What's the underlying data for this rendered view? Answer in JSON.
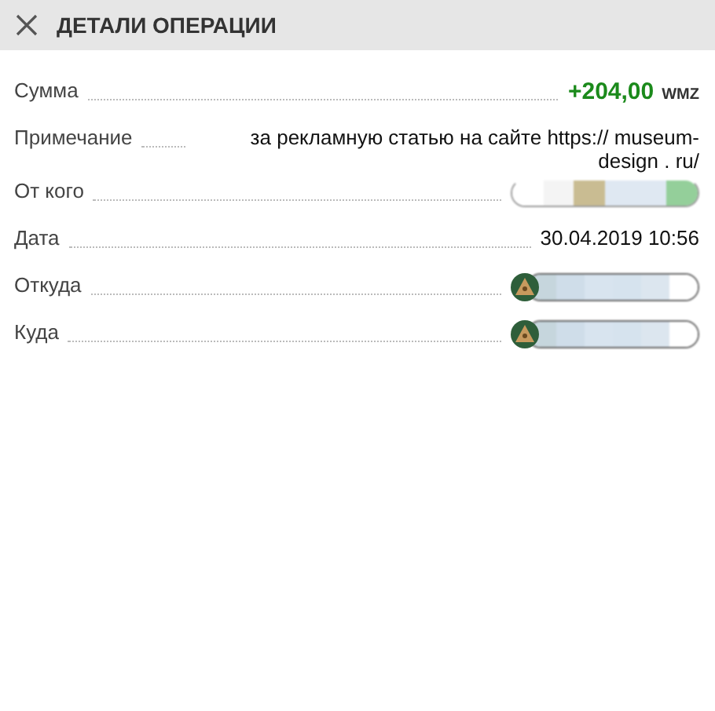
{
  "header": {
    "title": "ДЕТАЛИ ОПЕРАЦИИ"
  },
  "rows": [
    {
      "kind": "amount",
      "label": "Сумма",
      "value": "+204,00",
      "unit": "WMZ"
    },
    {
      "kind": "text",
      "label": "Примечание",
      "value": "за рекламную статью на сайте https:// museum-design . ru/"
    },
    {
      "kind": "masked",
      "label": "От кого"
    },
    {
      "kind": "text",
      "label": "Дата",
      "value": "30.04.2019 10:56"
    },
    {
      "kind": "wallet",
      "label": "Откуда"
    },
    {
      "kind": "wallet",
      "label": "Куда"
    }
  ]
}
